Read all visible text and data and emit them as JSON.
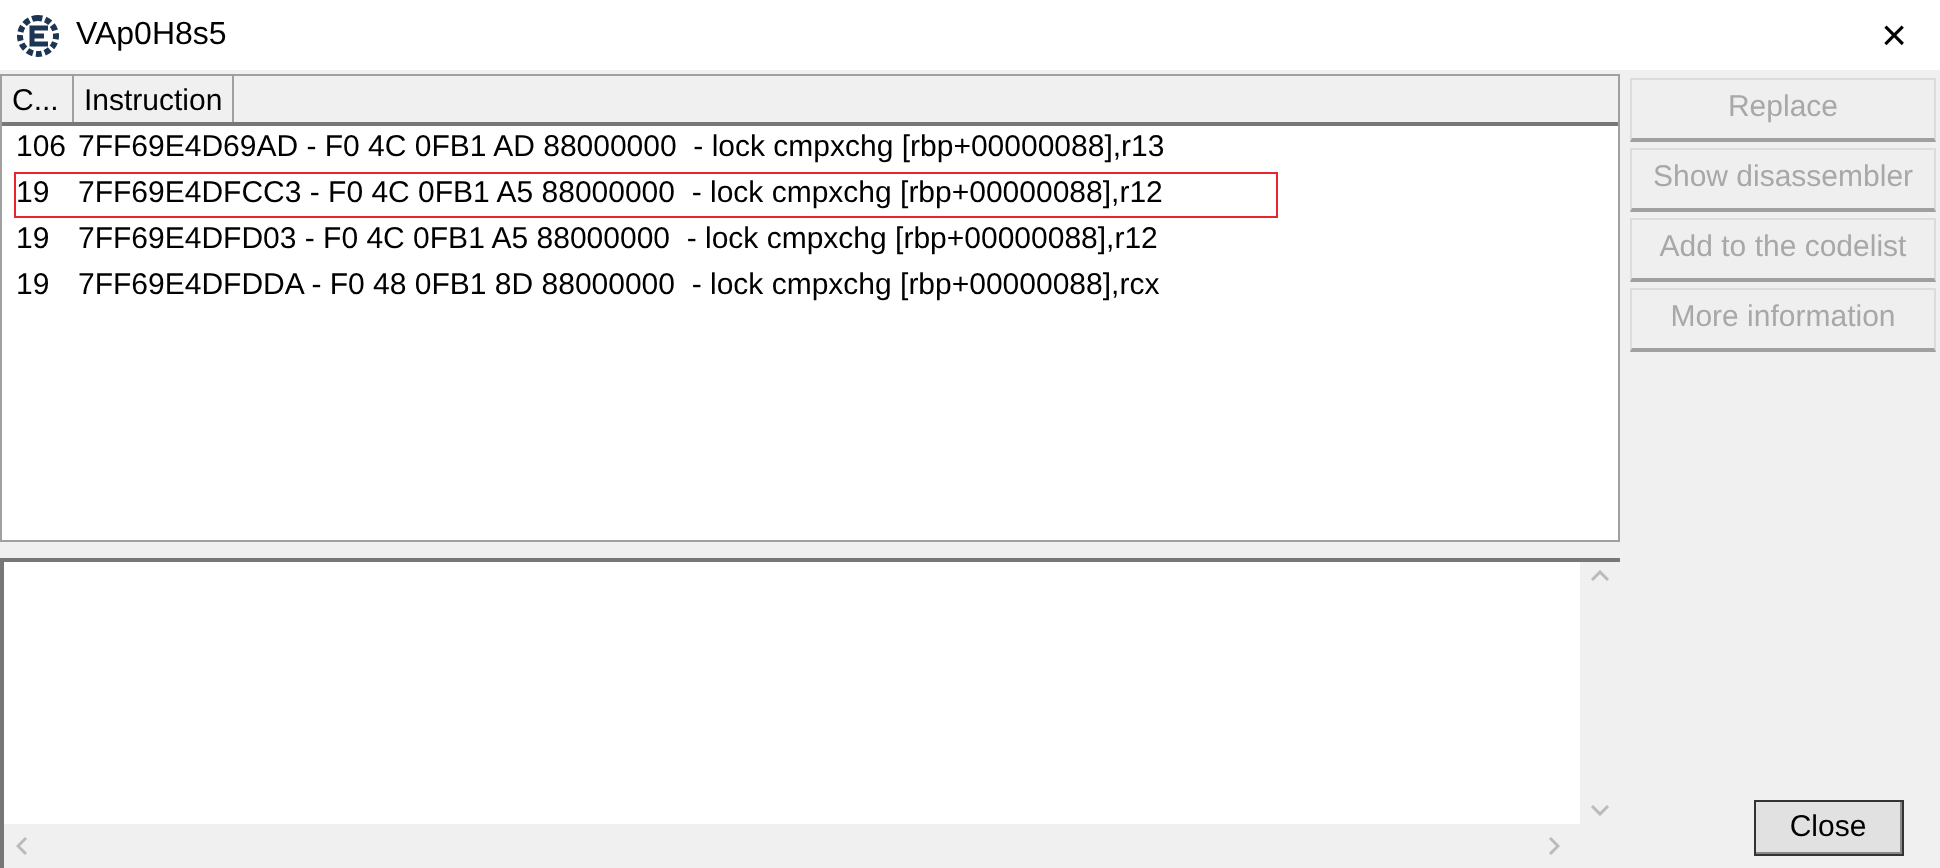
{
  "window": {
    "title": "VAp0H8s5",
    "close": "×"
  },
  "table": {
    "columns": [
      "C...",
      "Instruction"
    ],
    "rows": [
      {
        "count": "106",
        "instruction": "7FF69E4D69AD - F0 4C 0FB1 AD 88000000  - lock cmpxchg [rbp+00000088],r13",
        "highlighted": false
      },
      {
        "count": "19",
        "instruction": "7FF69E4DFCC3 - F0 4C 0FB1 A5 88000000  - lock cmpxchg [rbp+00000088],r12",
        "highlighted": true
      },
      {
        "count": "19",
        "instruction": "7FF69E4DFD03 - F0 4C 0FB1 A5 88000000  - lock cmpxchg [rbp+00000088],r12",
        "highlighted": false
      },
      {
        "count": "19",
        "instruction": "7FF69E4DFDDA - F0 48 0FB1 8D 88000000  - lock cmpxchg [rbp+00000088],rcx",
        "highlighted": false
      }
    ]
  },
  "buttons": [
    {
      "label": "Replace",
      "disabled": true
    },
    {
      "label": "Show disassembler",
      "disabled": true
    },
    {
      "label": "Add to the codelist",
      "disabled": true
    },
    {
      "label": "More information",
      "disabled": true
    }
  ],
  "close_button": {
    "label": "Close"
  }
}
